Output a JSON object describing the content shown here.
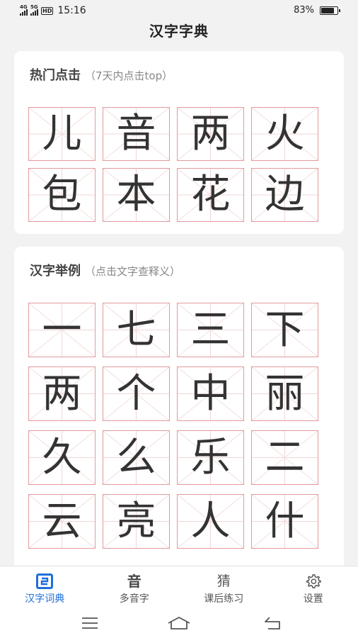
{
  "status_bar": {
    "network_1": "4G",
    "network_2": "5G",
    "hd_badge": "HD",
    "time": "15:16",
    "battery_text": "83%",
    "battery_level": 0.83
  },
  "app": {
    "title": "汉字字典"
  },
  "hot": {
    "title": "热门点击",
    "subtitle": "（7天内点击top）",
    "chars": [
      "儿",
      "音",
      "两",
      "火",
      "包",
      "本",
      "花",
      "边"
    ]
  },
  "examples": {
    "title": "汉字举例",
    "subtitle": "（点击文字查释义）",
    "chars": [
      "一",
      "七",
      "三",
      "下",
      "两",
      "个",
      "中",
      "丽",
      "久",
      "么",
      "乐",
      "二",
      "云",
      "亮",
      "人",
      "什"
    ]
  },
  "tabs": [
    {
      "label": "汉字词典",
      "icon": "dictionary-icon",
      "active": true
    },
    {
      "label": "多音字",
      "icon": "yin-char-icon",
      "glyph": "音",
      "active": false
    },
    {
      "label": "课后练习",
      "icon": "cai-char-icon",
      "glyph": "猜",
      "active": false
    },
    {
      "label": "设置",
      "icon": "gear-icon",
      "active": false
    }
  ],
  "colors": {
    "accent": "#1e6fd9",
    "grid_border": "#e39a9d",
    "background": "#f2f2f2"
  }
}
